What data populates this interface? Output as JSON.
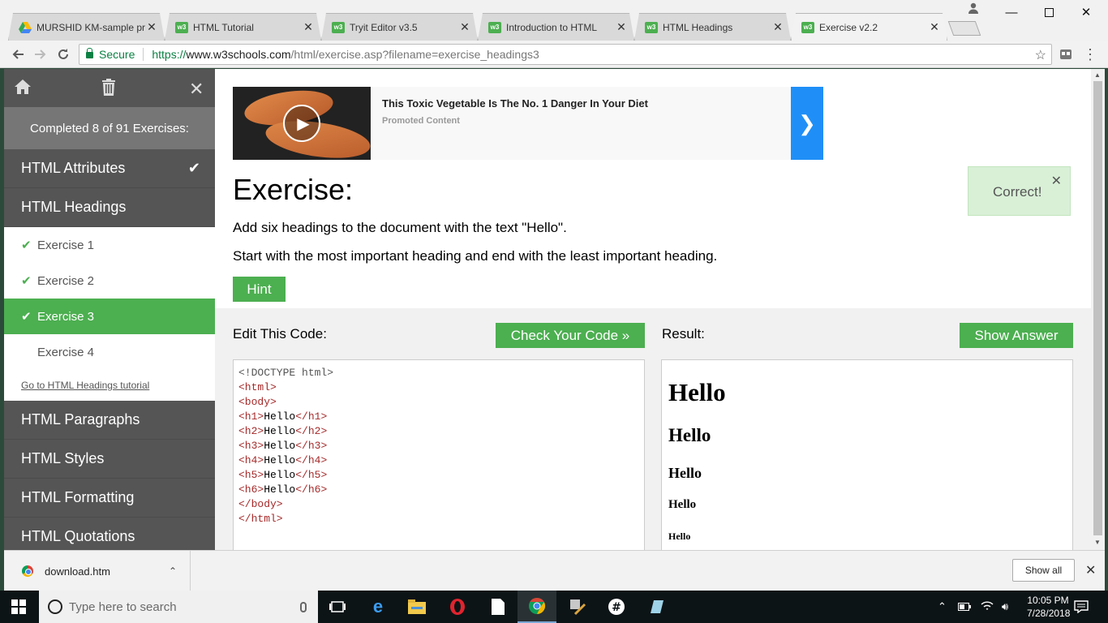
{
  "browser": {
    "tabs": [
      {
        "label": "MURSHID KM-sample pr",
        "favicon": "google-drive-icon",
        "active": false
      },
      {
        "label": "HTML Tutorial",
        "favicon": "w3schools-icon",
        "active": false
      },
      {
        "label": "Tryit Editor v3.5",
        "favicon": "w3schools-icon",
        "active": false
      },
      {
        "label": "Introduction to HTML",
        "favicon": "w3schools-icon",
        "active": false
      },
      {
        "label": "HTML Headings",
        "favicon": "w3schools-icon",
        "active": false
      },
      {
        "label": "Exercise v2.2",
        "favicon": "w3schools-icon",
        "active": true
      }
    ],
    "address": {
      "secure_label": "Secure",
      "scheme": "https://",
      "host": "www.w3schools.com",
      "path": "/html/exercise.asp?filename=exercise_headings3"
    }
  },
  "sidebar": {
    "progress": "Completed 8 of 91 Exercises:",
    "sections_before": [
      {
        "label": "HTML Attributes",
        "completed": true
      },
      {
        "label": "HTML Headings",
        "completed": false
      }
    ],
    "exercises": [
      {
        "label": "Exercise 1",
        "done": true
      },
      {
        "label": "Exercise 2",
        "done": true
      },
      {
        "label": "Exercise 3",
        "done": true
      },
      {
        "label": "Exercise 4",
        "done": false
      }
    ],
    "tutorial_link": "Go to HTML Headings tutorial",
    "sections_after": [
      {
        "label": "HTML Paragraphs"
      },
      {
        "label": "HTML Styles"
      },
      {
        "label": "HTML Formatting"
      },
      {
        "label": "HTML Quotations"
      }
    ]
  },
  "ad": {
    "headline": "This Toxic Vegetable Is The No. 1 Danger In Your Diet",
    "promoted": "Promoted Content"
  },
  "exercise": {
    "title": "Exercise:",
    "instruction_1": "Add six headings to the document with the text \"Hello\".",
    "instruction_2": "Start with the most important heading and end with the least important heading.",
    "hint_label": "Hint",
    "feedback": "Correct!"
  },
  "editor": {
    "label": "Edit This Code:",
    "check_label": "Check Your Code »",
    "code_lines": [
      {
        "pre": "",
        "open": "",
        "text": "<!DOCTYPE html>",
        "close": ""
      },
      {
        "pre": "",
        "open": "<html>",
        "text": "",
        "close": ""
      },
      {
        "pre": "",
        "open": "<body>",
        "text": "",
        "close": ""
      },
      {
        "pre": "",
        "open": "<h1>",
        "text": "Hello",
        "close": "</h1>"
      },
      {
        "pre": "",
        "open": "<h2>",
        "text": "Hello",
        "close": "</h2>"
      },
      {
        "pre": "",
        "open": "<h3>",
        "text": "Hello",
        "close": "</h3>"
      },
      {
        "pre": "",
        "open": "<h4>",
        "text": "Hello",
        "close": "</h4>"
      },
      {
        "pre": "",
        "open": "<h5>",
        "text": "Hello",
        "close": "</h5>"
      },
      {
        "pre": "",
        "open": "<h6>",
        "text": "Hello",
        "close": "</h6>"
      },
      {
        "pre": "",
        "open": "</body>",
        "text": "",
        "close": ""
      },
      {
        "pre": "",
        "open": "</html>",
        "text": "",
        "close": ""
      }
    ]
  },
  "result": {
    "label": "Result:",
    "show_answer_label": "Show Answer",
    "headings": [
      "Hello",
      "Hello",
      "Hello",
      "Hello",
      "Hello"
    ]
  },
  "downloads": {
    "file": "download.htm",
    "show_all": "Show all"
  },
  "taskbar": {
    "search_placeholder": "Type here to search",
    "time": "10:05 PM",
    "date": "7/28/2018"
  },
  "colors": {
    "accent_green": "#4caf50",
    "sidebar_bg": "#555555",
    "ad_blue": "#1f8ff7"
  }
}
